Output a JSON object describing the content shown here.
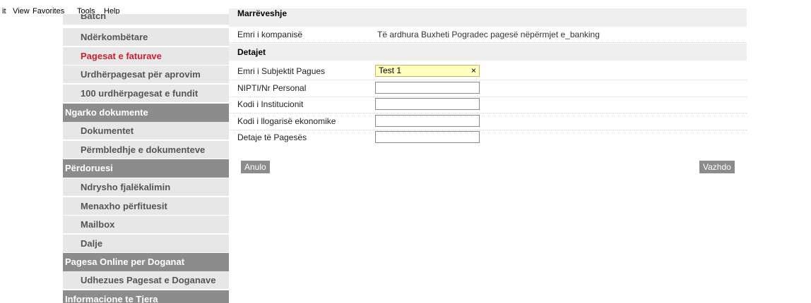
{
  "menubar": {
    "items": [
      "it",
      "View",
      "Favorites",
      "Tools",
      "Help"
    ]
  },
  "sidebar": {
    "items": [
      {
        "label": "Batch",
        "type": "item"
      },
      {
        "label": "Ndërkombëtare",
        "type": "item"
      },
      {
        "label": "Pagesat e faturave",
        "type": "item",
        "active": true
      },
      {
        "label": "Urdhërpagesat për aprovim",
        "type": "item"
      },
      {
        "label": "100 urdhërpagesat e fundit",
        "type": "item"
      },
      {
        "label": "Ngarko dokumente",
        "type": "head"
      },
      {
        "label": "Dokumentet",
        "type": "item"
      },
      {
        "label": "Përmbledhje e dokumenteve",
        "type": "item"
      },
      {
        "label": "Përdoruesi",
        "type": "head"
      },
      {
        "label": "Ndrysho fjalëkalimin",
        "type": "item"
      },
      {
        "label": "Menaxho përfituesit",
        "type": "item"
      },
      {
        "label": "Mailbox",
        "type": "item"
      },
      {
        "label": "Dalje",
        "type": "item"
      },
      {
        "label": "Pagesa Online per Doganat",
        "type": "head"
      },
      {
        "label": "Udhezues Pagesat e Doganave",
        "type": "item"
      },
      {
        "label": "Informacione te Tjera",
        "type": "head"
      }
    ]
  },
  "main": {
    "section_top": "Marrëveshje",
    "company_label": "Emri i kompanisë",
    "company_value": "Të ardhura Buxheti Pogradec pagesë nëpërmjet e_banking",
    "details_heading": "Detajet",
    "fields": [
      {
        "label": "Emri i Subjektit Pagues",
        "value": "Test 1"
      },
      {
        "label": "NIPTI/Nr Personal",
        "value": ""
      },
      {
        "label": "Kodi i Institucionit",
        "value": ""
      },
      {
        "label": "Kodi i llogarisë ekonomike",
        "value": ""
      },
      {
        "label": "Detaje të Pagesës",
        "value": ""
      }
    ],
    "clear_glyph": "×",
    "cancel_label": "Anulo",
    "continue_label": "Vazhdo"
  },
  "colors": {
    "sidebar_item_bg": "#e7e7e7",
    "sidebar_head_bg": "#8c8c8c",
    "active_item": "#cc1f2e",
    "filled_field_bg": "#ffffc0",
    "button_bg": "#8c8c8c"
  }
}
